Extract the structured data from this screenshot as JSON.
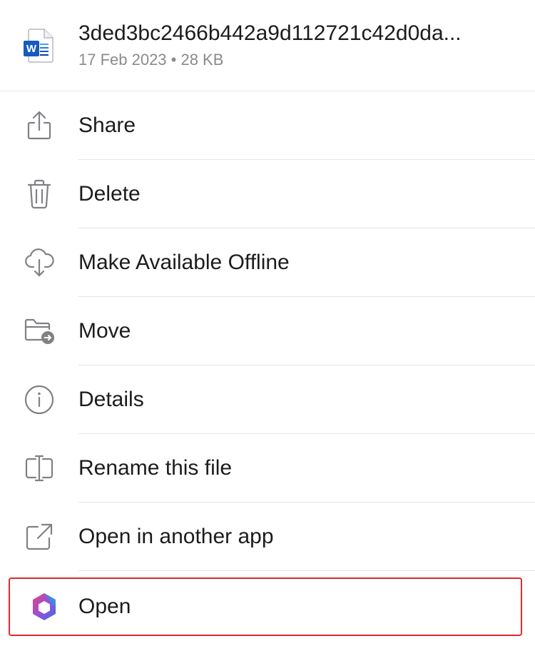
{
  "file": {
    "name": "3ded3bc2466b442a9d112721c42d0da...",
    "meta": "17 Feb 2023 • 28 KB",
    "icon": "word-document-icon",
    "icon_letter": "W",
    "brand_color": "#185ABD"
  },
  "menu": {
    "items": [
      {
        "label": "Share",
        "icon": "share-icon"
      },
      {
        "label": "Delete",
        "icon": "trash-icon"
      },
      {
        "label": "Make Available Offline",
        "icon": "cloud-download-icon"
      },
      {
        "label": "Move",
        "icon": "folder-move-icon"
      },
      {
        "label": "Details",
        "icon": "info-icon"
      },
      {
        "label": "Rename this file",
        "icon": "rename-icon"
      },
      {
        "label": "Open in another app",
        "icon": "external-link-icon"
      },
      {
        "label": "Open",
        "icon": "microsoft-365-icon"
      }
    ]
  },
  "colors": {
    "icon_gray": "#808085",
    "highlight_border": "#E0282E"
  }
}
